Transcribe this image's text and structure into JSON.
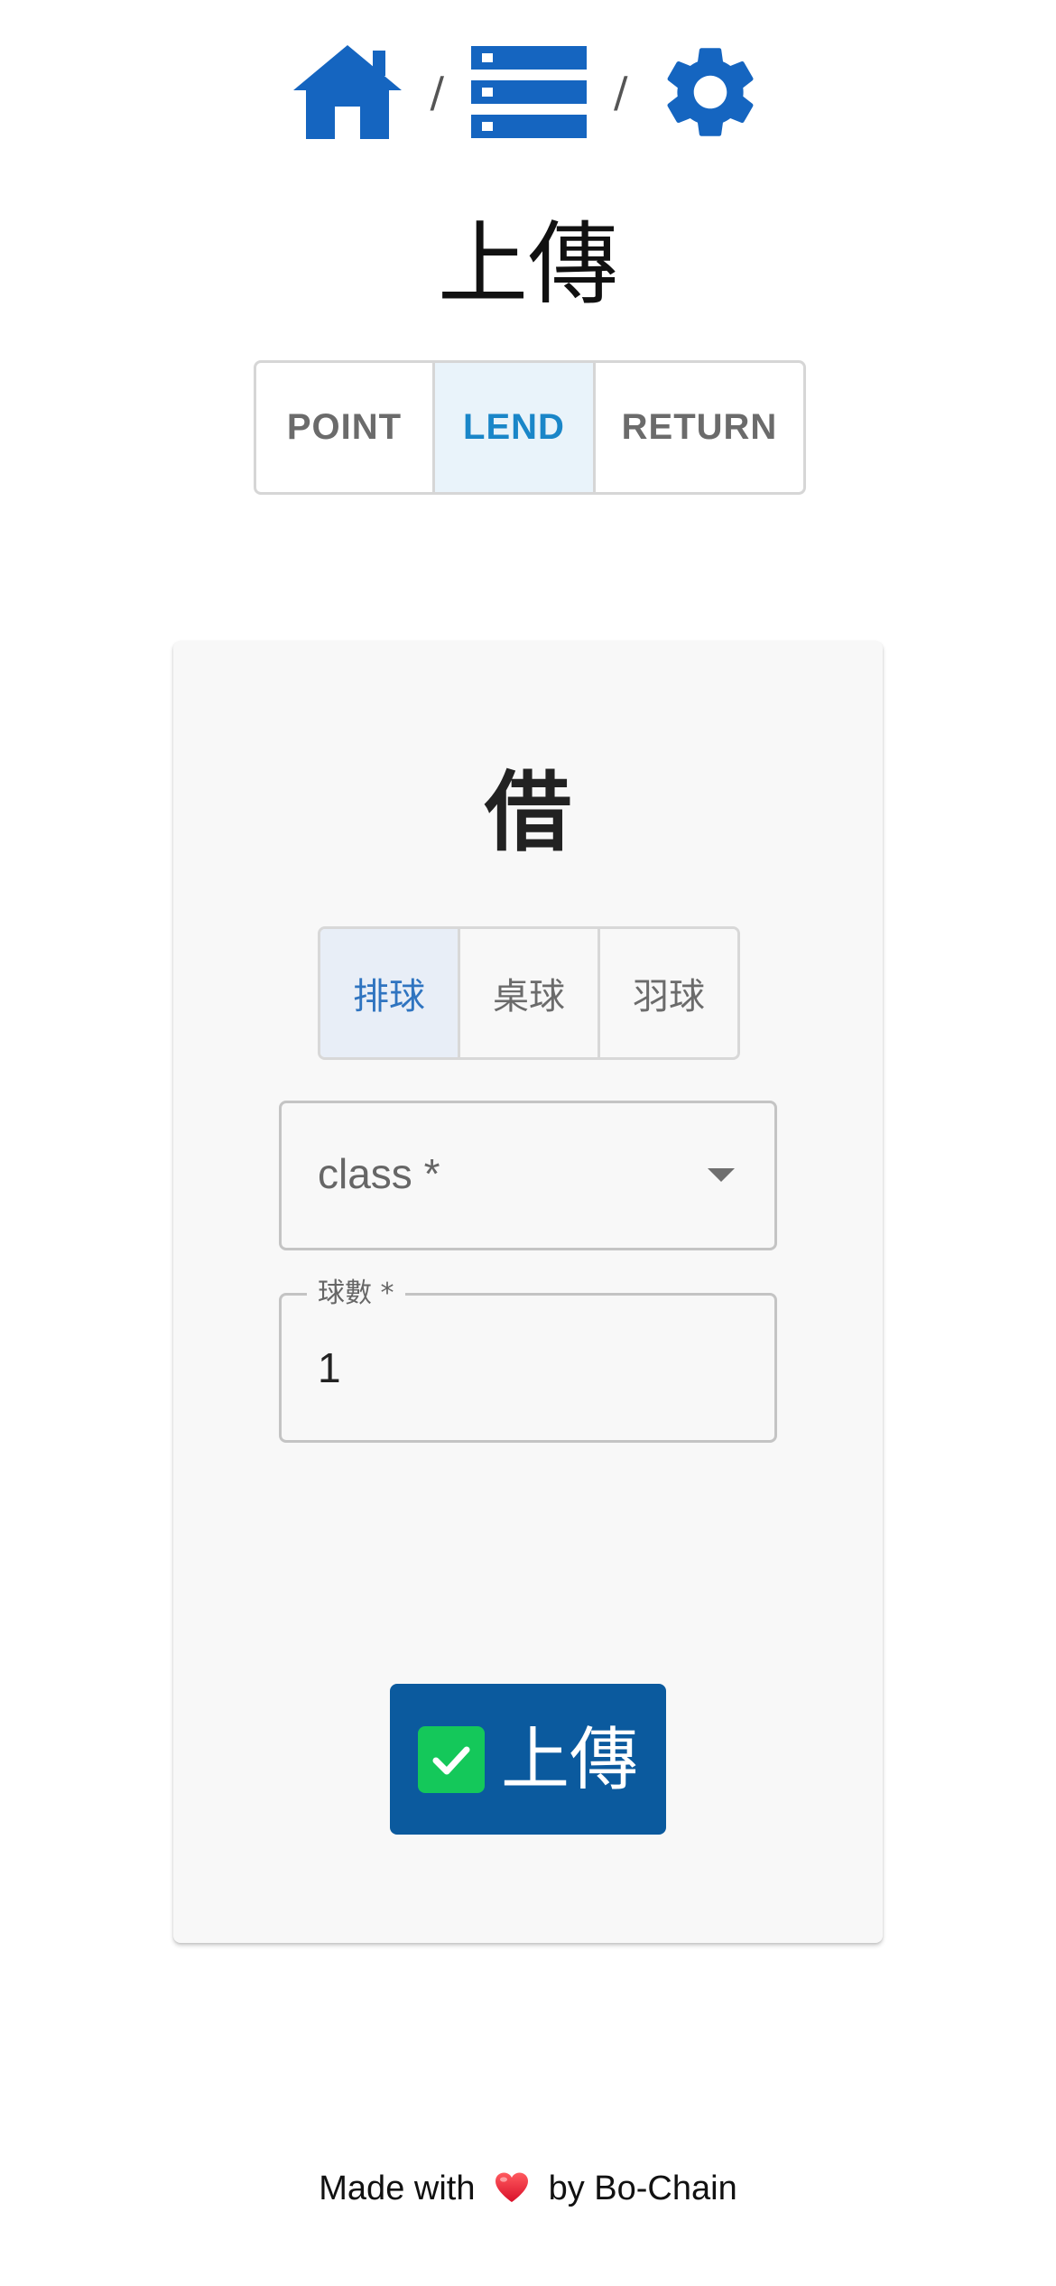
{
  "nav": {
    "home_icon": "home-icon",
    "list_icon": "list-icon",
    "settings_icon": "gear-icon",
    "separator_1": "/",
    "separator_2": "/",
    "accent_color": "#1565c0"
  },
  "page_title": "上傳",
  "mode_toggle": {
    "options": [
      "POINT",
      "LEND",
      "RETURN"
    ],
    "selected": "LEND"
  },
  "card": {
    "title": "借",
    "sport_toggle": {
      "options": [
        "排球",
        "桌球",
        "羽球"
      ],
      "selected": "排球"
    },
    "class_select": {
      "label": "class *"
    },
    "ball_count": {
      "label": "球數 *",
      "value": "1"
    },
    "submit": {
      "label": "上傳",
      "icon": "check-icon",
      "color": "#0b5a9e"
    }
  },
  "footer": {
    "made_with": "Made with",
    "by": "by Bo-Chain",
    "icon": "heart-icon"
  }
}
